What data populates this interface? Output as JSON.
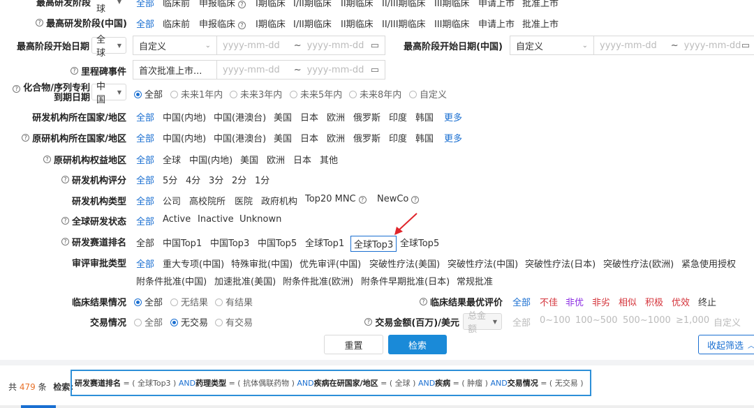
{
  "rows": {
    "r0": {
      "label": "最高研发阶段",
      "region": "全球",
      "options": [
        "全部",
        "临床前",
        "申报临床",
        "I期临床",
        "I/II期临床",
        "II期临床",
        "II/III期临床",
        "III期临床",
        "申请上市",
        "批准上市"
      ]
    },
    "r1": {
      "label": "最高研发阶段(中国)",
      "options": [
        "全部",
        "临床前",
        "申报临床",
        "I期临床",
        "I/II期临床",
        "II期临床",
        "II/III期临床",
        "III期临床",
        "申请上市",
        "批准上市"
      ]
    },
    "r2": {
      "label": "最高阶段开始日期",
      "region": "全球",
      "dropdown": "自定义",
      "date_from": "yyyy-mm-dd",
      "tilde": "~",
      "date_to": "yyyy-mm-dd",
      "label2": "最高阶段开始日期(中国)",
      "dropdown2": "自定义"
    },
    "r3": {
      "label": "里程碑事件",
      "dropdown": "首次批准上市...",
      "date_from": "yyyy-mm-dd",
      "tilde": "~",
      "date_to": "yyyy-mm-dd"
    },
    "r4": {
      "label_line1": "化合物/序列专利",
      "label_line2": "到期日期",
      "region": "中国",
      "options": [
        "全部",
        "未来1年内",
        "未来3年内",
        "未来5年内",
        "未来8年内",
        "自定义"
      ]
    },
    "r5": {
      "label": "研发机构所在国家/地区",
      "options": [
        "全部",
        "中国(内地)",
        "中国(港澳台)",
        "美国",
        "日本",
        "欧洲",
        "俄罗斯",
        "印度",
        "韩国"
      ],
      "more": "更多"
    },
    "r6": {
      "label": "原研机构所在国家/地区",
      "options": [
        "全部",
        "中国(内地)",
        "中国(港澳台)",
        "美国",
        "日本",
        "欧洲",
        "俄罗斯",
        "印度",
        "韩国"
      ],
      "more": "更多"
    },
    "r7": {
      "label": "原研机构权益地区",
      "options": [
        "全部",
        "全球",
        "中国(内地)",
        "美国",
        "欧洲",
        "日本",
        "其他"
      ]
    },
    "r8": {
      "label": "研发机构评分",
      "options": [
        "全部",
        "5分",
        "4分",
        "3分",
        "2分",
        "1分"
      ]
    },
    "r9": {
      "label": "研发机构类型",
      "options": [
        "全部",
        "公司",
        "高校院所",
        "医院",
        "政府机构",
        "Top20 MNC",
        "NewCo"
      ]
    },
    "r10": {
      "label": "全球研发状态",
      "options": [
        "全部",
        "Active",
        "Inactive",
        "Unknown"
      ]
    },
    "r11": {
      "label": "研发赛道排名",
      "options": [
        "全部",
        "中国Top1",
        "中国Top3",
        "中国Top5",
        "全球Top1",
        "全球Top3",
        "全球Top5"
      ]
    },
    "r12": {
      "label": "审评审批类型",
      "options": [
        "全部",
        "重大专项(中国)",
        "特殊审批(中国)",
        "优先审评(中国)",
        "突破性疗法(美国)",
        "突破性疗法(中国)",
        "突破性疗法(日本)",
        "突破性疗法(欧洲)",
        "紧急使用授权"
      ],
      "options2": [
        "附条件批准(中国)",
        "加速批准(美国)",
        "附条件批准(欧洲)",
        "附条件早期批准(日本)",
        "常规批准"
      ]
    },
    "r13": {
      "label": "临床结果情况",
      "options": [
        "全部",
        "无结果",
        "有结果"
      ],
      "label2": "临床结果最优评价",
      "options2": [
        "全部",
        "不佳",
        "非优",
        "非劣",
        "相似",
        "积极",
        "优效",
        "终止"
      ]
    },
    "r14": {
      "label": "交易情况",
      "options": [
        "全部",
        "无交易",
        "有交易"
      ],
      "label2": "交易金额(百万)/美元",
      "select": "总金额",
      "options2": [
        "全部",
        "0~100",
        "100~500",
        "500~1000",
        "≥1,000",
        "自定义"
      ]
    },
    "buttons": {
      "reset": "重置",
      "search": "检索",
      "collapse": "收起筛选"
    },
    "result": {
      "prefix": "共",
      "count": "479",
      "suffix": "条",
      "search_label": "检索:",
      "query": [
        {
          "k": "研发赛道排名",
          "v": " = ( 全球Top3 ) "
        },
        {
          "op": "AND"
        },
        {
          "k": " 药理类型",
          "v": " = ( 抗体偶联药物 ) "
        },
        {
          "op": "AND"
        },
        {
          "k": " 疾病在研国家/地区",
          "v": " = ( 全球 ) "
        },
        {
          "op": "AND"
        },
        {
          "k": " 疾病",
          "v": " = ( 肿瘤 ) "
        },
        {
          "op": "AND"
        },
        {
          "k": " 交易情况",
          "v": " = ( 无交易 )"
        }
      ]
    },
    "colors": {
      "accent": "#1a6fd1",
      "red": "#d4333a",
      "purple": "#8a2be2",
      "button": "#1a8ad8"
    }
  }
}
